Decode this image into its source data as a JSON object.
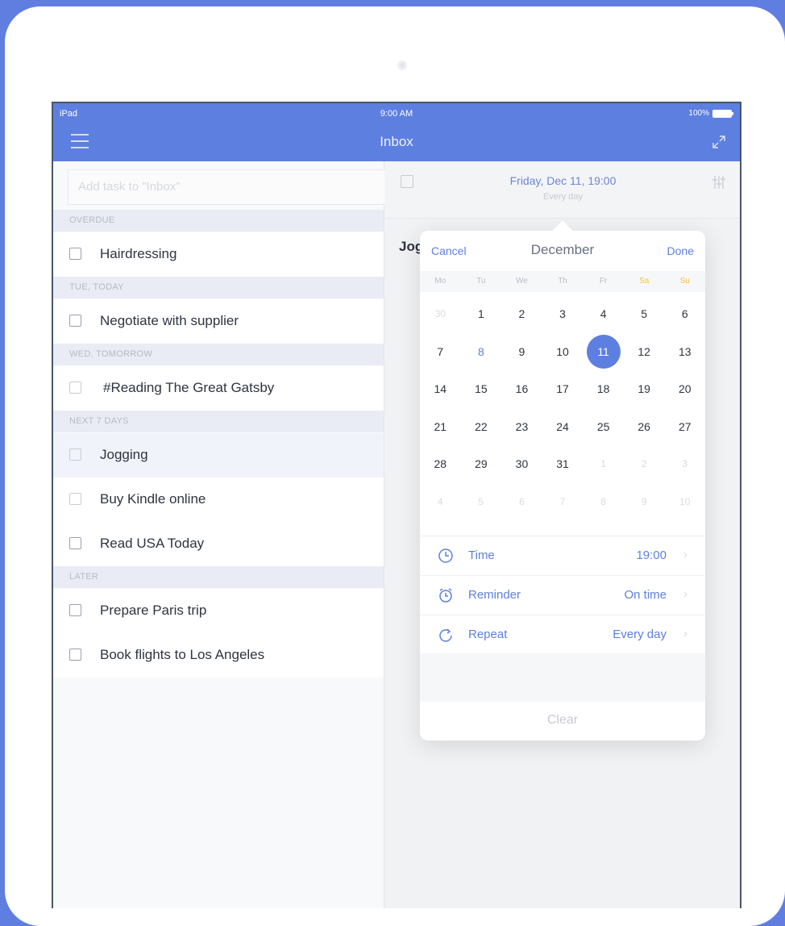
{
  "status_bar": {
    "carrier": "iPad",
    "time": "9:00 AM",
    "battery": "100%"
  },
  "nav": {
    "title": "Inbox"
  },
  "add_task": {
    "placeholder": "Add task to \"Inbox\""
  },
  "sections": [
    {
      "header": "OVERDUE",
      "tasks": [
        "Hairdressing"
      ]
    },
    {
      "header": "TUE, TODAY",
      "tasks": [
        "Negotiate with supplier"
      ]
    },
    {
      "header": "WED, TOMORROW",
      "tasks": [
        "#Reading The Great Gatsby"
      ]
    },
    {
      "header": "NEXT 7 DAYS",
      "tasks": [
        "Jogging",
        "Buy Kindle online",
        "Read USA Today"
      ]
    },
    {
      "header": "LATER",
      "tasks": [
        "Prepare Paris trip",
        "Book flights to Los Angeles"
      ]
    }
  ],
  "detail": {
    "due_date": "Friday, Dec 11, 19:00",
    "repeat_text": "Every day",
    "task_title_visible": "Jog"
  },
  "calendar": {
    "cancel_label": "Cancel",
    "month": "December",
    "done_label": "Done",
    "weekdays": [
      "Mo",
      "Tu",
      "We",
      "Th",
      "Fr",
      "Sa",
      "Su"
    ],
    "weeks": [
      [
        "30",
        "1",
        "2",
        "3",
        "4",
        "5",
        "6"
      ],
      [
        "7",
        "8",
        "9",
        "10",
        "11",
        "12",
        "13"
      ],
      [
        "14",
        "15",
        "16",
        "17",
        "18",
        "19",
        "20"
      ],
      [
        "21",
        "22",
        "23",
        "24",
        "25",
        "26",
        "27"
      ],
      [
        "28",
        "29",
        "30",
        "31",
        "1",
        "2",
        "3"
      ],
      [
        "4",
        "5",
        "6",
        "7",
        "8",
        "9",
        "10"
      ]
    ],
    "today": "8",
    "selected": "11",
    "options": [
      {
        "icon": "clock-icon",
        "label": "Time",
        "value": "19:00"
      },
      {
        "icon": "alarm-icon",
        "label": "Reminder",
        "value": "On time"
      },
      {
        "icon": "repeat-icon",
        "label": "Repeat",
        "value": "Every day"
      }
    ],
    "clear_label": "Clear"
  },
  "colors": {
    "accent": "#5d7fdf",
    "weekend": "#f5c242"
  }
}
